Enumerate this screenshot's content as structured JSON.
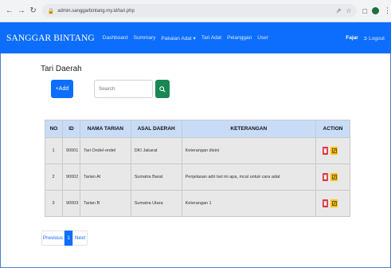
{
  "browser": {
    "url": "admin.sanggarbintang.my.id/tari.php"
  },
  "navbar": {
    "brand": "SANGGAR BINTANG",
    "links": [
      "Dashboard",
      "Summary",
      "Pakaian Adat",
      "Tari Adat",
      "Pelanggan",
      "User"
    ],
    "user": "Fajar",
    "logout": "Logout"
  },
  "page": {
    "title": "Tari Daerah",
    "add_label": "+Add",
    "search_placeholder": "Search"
  },
  "table": {
    "headers": [
      "NO",
      "ID",
      "NAMA TARIAN",
      "ASAL DAERAH",
      "KETERANGAN",
      "ACTION"
    ],
    "rows": [
      {
        "no": "1",
        "id": "90001",
        "nama": "Tari Ondel-ondel",
        "asal": "DKI Jakarat",
        "ket": "Keterangan disini"
      },
      {
        "no": "2",
        "id": "90002",
        "nama": "Tarian AI",
        "asal": "Sumatra Barat",
        "ket": "Penjelasan adri tari ini apa, mcal untuk cara adat"
      },
      {
        "no": "3",
        "id": "90003",
        "nama": "Tarian B",
        "asal": "Sumatra Utara",
        "ket": "Keterangan 1"
      }
    ]
  },
  "pagination": {
    "previous": "Previous",
    "current": "1",
    "next": "Next"
  },
  "colors": {
    "primary": "#0d6efd",
    "success": "#198754",
    "danger": "#dc3545",
    "warning": "#ffc107",
    "table_header": "#c8dcf7"
  }
}
